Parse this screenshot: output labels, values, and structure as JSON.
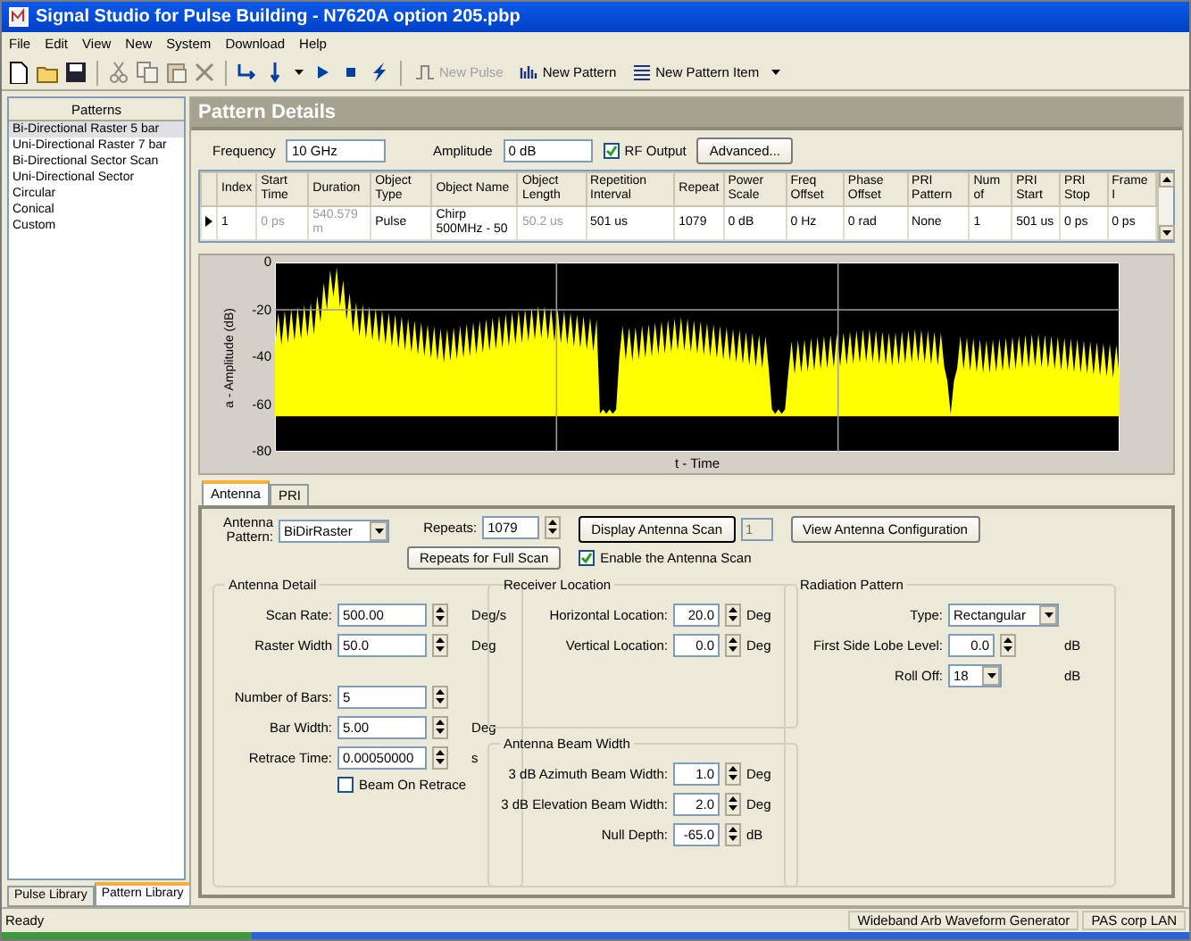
{
  "window": {
    "title": "Signal Studio for Pulse Building - N7620A option 205.pbp"
  },
  "menu": [
    "File",
    "Edit",
    "View",
    "New",
    "System",
    "Download",
    "Help"
  ],
  "toolbar": [
    {
      "kind": "icon",
      "disabled": false
    },
    {
      "kind": "icon",
      "disabled": false
    },
    {
      "kind": "icon",
      "disabled": false
    },
    {
      "kind": "separator"
    },
    {
      "kind": "icon",
      "disabled": true
    },
    {
      "kind": "icon",
      "disabled": true
    },
    {
      "kind": "icon",
      "disabled": true
    },
    {
      "kind": "icon",
      "disabled": true
    },
    {
      "kind": "separator"
    },
    {
      "kind": "icon",
      "disabled": false
    },
    {
      "kind": "icon",
      "disabled": false
    },
    {
      "kind": "caret",
      "disabled": false
    },
    {
      "kind": "icon",
      "disabled": false
    },
    {
      "kind": "icon",
      "disabled": false
    },
    {
      "kind": "icon",
      "disabled": false
    },
    {
      "kind": "separator"
    },
    {
      "kind": "text",
      "label": "New Pulse",
      "disabled": true
    },
    {
      "kind": "text",
      "label": "New Pattern",
      "disabled": false
    },
    {
      "kind": "text",
      "label": "New Pattern Item",
      "disabled": false
    },
    {
      "kind": "caret",
      "disabled": false
    }
  ],
  "patterns": {
    "title": "Patterns",
    "items": [
      {
        "label": "Bi-Directional Raster 5 bar",
        "selected": true
      },
      {
        "label": "Uni-Directional Raster 7 bar",
        "selected": false
      },
      {
        "label": "Bi-Directional Sector Scan",
        "selected": false
      },
      {
        "label": "Uni-Directional Sector",
        "selected": false
      },
      {
        "label": "Circular",
        "selected": false
      },
      {
        "label": "Conical",
        "selected": false
      },
      {
        "label": "Custom",
        "selected": false
      }
    ]
  },
  "pattern_details": {
    "title": "Pattern Details",
    "frequency": {
      "label": "Frequency",
      "value": "10 GHz"
    },
    "amplitude": {
      "label": "Amplitude",
      "value": "0 dB"
    },
    "rf_output": {
      "label": "RF Output",
      "checked": true
    },
    "advanced_button": "Advanced..."
  },
  "table": {
    "columns": [
      "Index",
      "Start Time",
      "Duration",
      "Object Type",
      "Object Name",
      "Object Length",
      "Repetition Interval",
      "Repeat",
      "Power Scale",
      "Freq Offset",
      "Phase Offset",
      "PRI Pattern",
      "Num of",
      "PRI Start",
      "PRI Stop",
      "Frame I"
    ],
    "rows": [
      {
        "current": true,
        "cells": [
          {
            "text": "1",
            "disabled": false
          },
          {
            "text": "0 ps",
            "disabled": true
          },
          {
            "text": "540.579 m",
            "disabled": true
          },
          {
            "text": "Pulse",
            "disabled": false
          },
          {
            "text": "Chirp 500MHz - 50",
            "disabled": false
          },
          {
            "text": "50.2 us",
            "disabled": true
          },
          {
            "text": "501 us",
            "disabled": false
          },
          {
            "text": "1079",
            "disabled": false
          },
          {
            "text": "0 dB",
            "disabled": false
          },
          {
            "text": "0 Hz",
            "disabled": false
          },
          {
            "text": "0 rad",
            "disabled": false
          },
          {
            "text": "None",
            "disabled": false
          },
          {
            "text": "1",
            "disabled": false
          },
          {
            "text": "501 us",
            "disabled": false
          },
          {
            "text": "0 ps",
            "disabled": false
          },
          {
            "text": "0 ps",
            "disabled": false
          }
        ]
      }
    ]
  },
  "chart": {
    "ylabel": "a - Amplitude (dB)",
    "xlabel": "t - Time",
    "yticks": [
      "0",
      "-20",
      "-40",
      "-60",
      "-80"
    ]
  },
  "tabs": [
    {
      "label": "Antenna",
      "selected": true
    },
    {
      "label": "PRI",
      "selected": false
    }
  ],
  "antenna": {
    "pattern": {
      "label": "Antenna Pattern:",
      "value": "BiDirRaster"
    },
    "repeats": {
      "label": "Repeats:",
      "value": "1079"
    },
    "full_scan_button": "Repeats for Full Scan",
    "display_button": "Display Antenna Scan",
    "scan_index": {
      "value": "1",
      "disabled": true
    },
    "enable_scan": {
      "label": "Enable the Antenna Scan",
      "checked": true
    },
    "view_button": "View Antenna Configuration",
    "columns": [
      [
        {
          "title": "Antenna Detail",
          "sections": [
            [
              {
                "kind": "spin",
                "label": "Scan Rate:",
                "value": "500.00",
                "unit": "Deg/s"
              },
              {
                "kind": "spin",
                "label": "Raster Width",
                "value": "50.0",
                "unit": "Deg"
              }
            ],
            [
              {
                "kind": "spin",
                "label": "Number of Bars:",
                "value": "5"
              },
              {
                "kind": "spin",
                "label": "Bar Width:",
                "value": "5.00",
                "unit": "Deg"
              },
              {
                "kind": "spin",
                "label": "Retrace Time:",
                "value": "0.00050000",
                "unit": "s"
              },
              {
                "kind": "check",
                "label": "Beam On Retrace",
                "checked": false
              }
            ]
          ]
        }
      ],
      [
        {
          "title": "Receiver Location",
          "sections": [
            [
              {
                "kind": "spin",
                "label": "Horizontal Location:",
                "value": "20.0",
                "unit": "Deg"
              },
              {
                "kind": "spin",
                "label": "Vertical Location:",
                "value": "0.0",
                "unit": "Deg"
              }
            ]
          ]
        },
        {
          "title": "Antenna Beam Width",
          "sections": [
            [
              {
                "kind": "spin",
                "label": "3 dB Azimuth Beam Width:",
                "value": "1.0",
                "unit": "Deg"
              },
              {
                "kind": "spin",
                "label": "3 dB Elevation Beam Width:",
                "value": "2.0",
                "unit": "Deg"
              },
              {
                "kind": "spin",
                "label": "Null Depth:",
                "value": "-65.0",
                "unit": "dB"
              }
            ]
          ]
        }
      ],
      [
        {
          "title": "Radiation Pattern",
          "sections": [
            [
              {
                "kind": "select",
                "label": "Type:",
                "value": "Rectangular"
              },
              {
                "kind": "spin",
                "label": "First Side Lobe Level:",
                "value": "0.0",
                "unit": "dB"
              },
              {
                "kind": "select",
                "label": "Roll Off:",
                "value": "18",
                "unit": "dB"
              }
            ]
          ]
        }
      ]
    ]
  },
  "library_tabs": [
    {
      "label": "Pulse Library",
      "selected": false
    },
    {
      "label": "Pattern Library",
      "selected": true
    }
  ],
  "status_bar": {
    "message": "Ready",
    "panels": [
      "Wideband Arb Waveform Generator",
      "PAS corp LAN"
    ]
  }
}
